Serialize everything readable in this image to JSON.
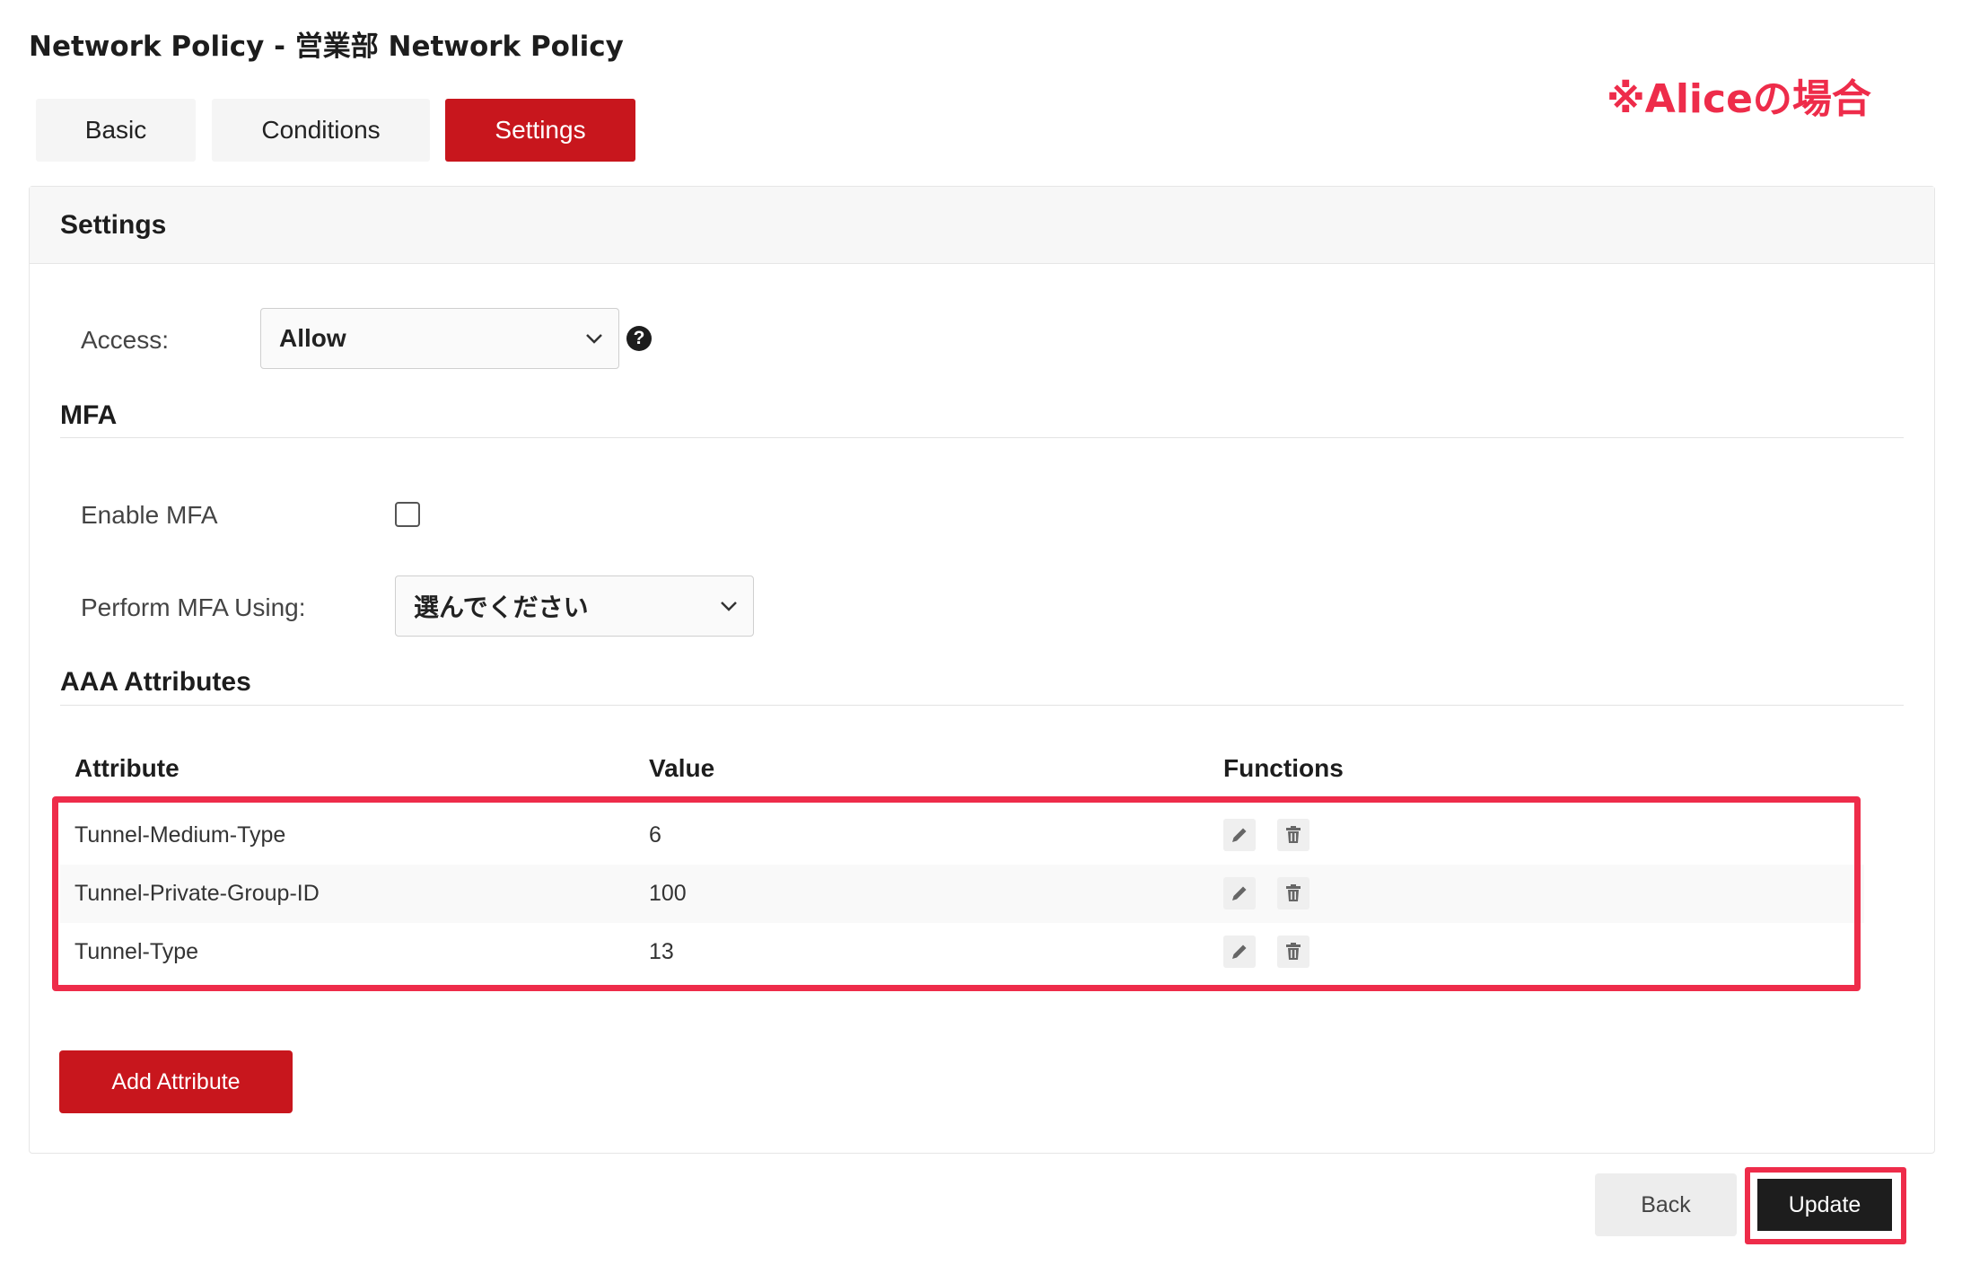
{
  "page": {
    "title": "Network Policy - 営業部 Network Policy",
    "note": "※Aliceの場合"
  },
  "tabs": [
    {
      "label": "Basic",
      "active": false
    },
    {
      "label": "Conditions",
      "active": false
    },
    {
      "label": "Settings",
      "active": true
    }
  ],
  "settings": {
    "header": "Settings",
    "access_label": "Access:",
    "access_value": "Allow",
    "help_glyph": "?"
  },
  "mfa": {
    "title": "MFA",
    "enable_label": "Enable MFA",
    "enable_checked": false,
    "perform_label": "Perform MFA Using:",
    "perform_value": "選んでください"
  },
  "aaa": {
    "title": "AAA Attributes",
    "columns": [
      "Attribute",
      "Value",
      "Functions"
    ],
    "rows": [
      {
        "attribute": "Tunnel-Medium-Type",
        "value": "6"
      },
      {
        "attribute": "Tunnel-Private-Group-ID",
        "value": "100"
      },
      {
        "attribute": "Tunnel-Type",
        "value": "13"
      }
    ],
    "add_button": "Add Attribute"
  },
  "footer": {
    "back_label": "Back",
    "update_label": "Update"
  },
  "colors": {
    "brand_red": "#c8161d",
    "annotation_red": "#ee2c4a",
    "dark_button": "#1d1d1d"
  },
  "icons": {
    "edit": "pencil-icon",
    "delete": "trash-icon",
    "dropdown": "chevron-down-icon",
    "help": "question-circle-icon"
  }
}
